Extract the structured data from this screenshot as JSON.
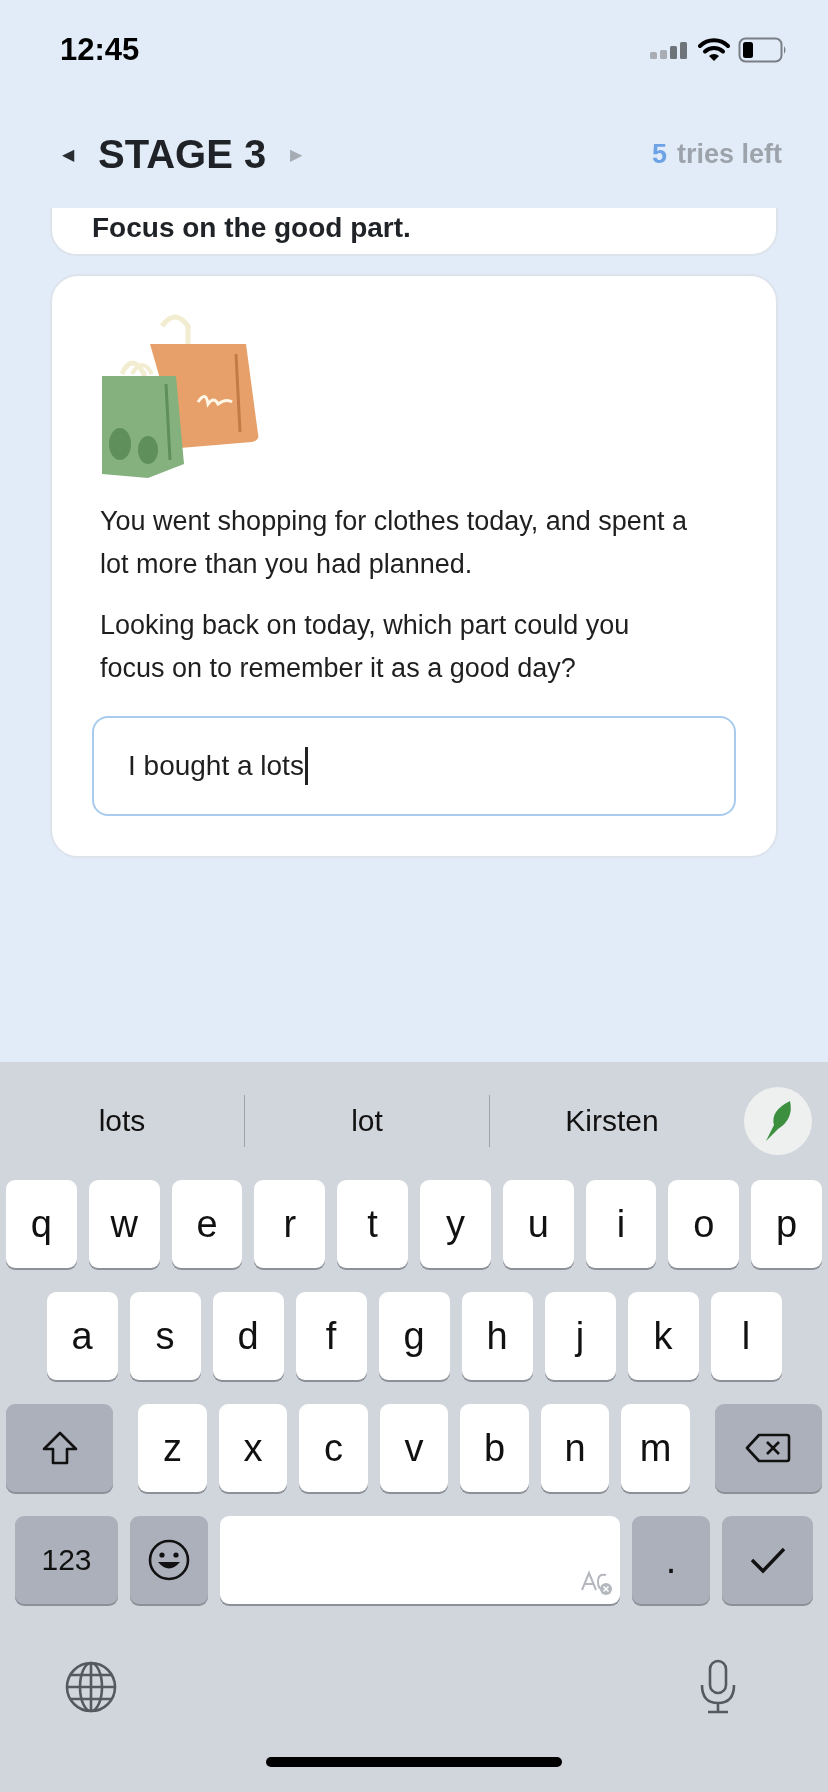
{
  "status_bar": {
    "time": "12:45"
  },
  "header": {
    "prev": {
      "glyph": "◀",
      "disabled": false
    },
    "title": "STAGE 3",
    "next": {
      "glyph": "▶",
      "disabled": true
    },
    "tries_count": "5",
    "tries_label": "tries left"
  },
  "previous_card": {
    "text": "Focus on the good part."
  },
  "question_card": {
    "picture": {
      "kind": "picture"
    },
    "paragraphs": [
      "You went shopping for clothes today, and spent a lot more than you had planned.",
      "Looking back on today, which part could you focus on to remember it as a good day?"
    ],
    "answer": {
      "value": "I bought a lots"
    }
  },
  "keyboard": {
    "suggestions": [
      "lots",
      "lot",
      "Kirsten"
    ],
    "rows": [
      [
        "q",
        "w",
        "e",
        "r",
        "t",
        "y",
        "u",
        "i",
        "o",
        "p"
      ],
      [
        "a",
        "s",
        "d",
        "f",
        "g",
        "h",
        "j",
        "k",
        "l"
      ],
      [
        "z",
        "x",
        "c",
        "v",
        "b",
        "n",
        "m"
      ]
    ],
    "numbers_key": "123",
    "period_key": "."
  }
}
